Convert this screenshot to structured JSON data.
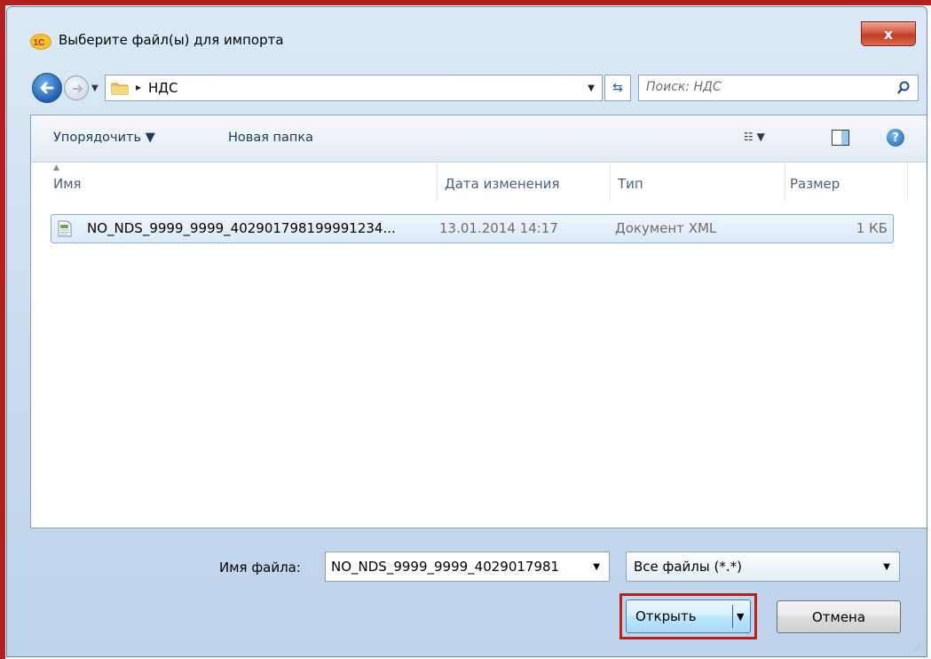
{
  "window": {
    "title": "Выберите файл(ы) для импорта",
    "close_label": "x"
  },
  "address": {
    "crumb": "НДС",
    "search_placeholder": "Поиск: НДС"
  },
  "toolbar": {
    "organize_label": "Упорядочить ▼",
    "new_folder_label": "Новая папка"
  },
  "columns": {
    "name": "Имя",
    "date": "Дата изменения",
    "type": "Тип",
    "size": "Размер"
  },
  "files": [
    {
      "name": "NO_NDS_9999_9999_402901798199991234...",
      "date": "13.01.2014 14:17",
      "type": "Документ XML",
      "size": "1 КБ"
    }
  ],
  "footer": {
    "filename_label": "Имя файла:",
    "filename_value": "NO_NDS_9999_9999_4029017981",
    "filter_value": "Все файлы (*.*)",
    "open_label": "Открыть",
    "cancel_label": "Отмена"
  },
  "colors": {
    "highlight": "#c11b1b",
    "window_frame": "#c7dbef",
    "selection": "#dce9f8"
  },
  "icons": [
    "1c-app-icon",
    "back-arrow-icon",
    "forward-arrow-icon",
    "folder-icon",
    "refresh-icon",
    "search-icon",
    "views-icon",
    "preview-pane-icon",
    "help-icon",
    "xml-file-icon"
  ]
}
